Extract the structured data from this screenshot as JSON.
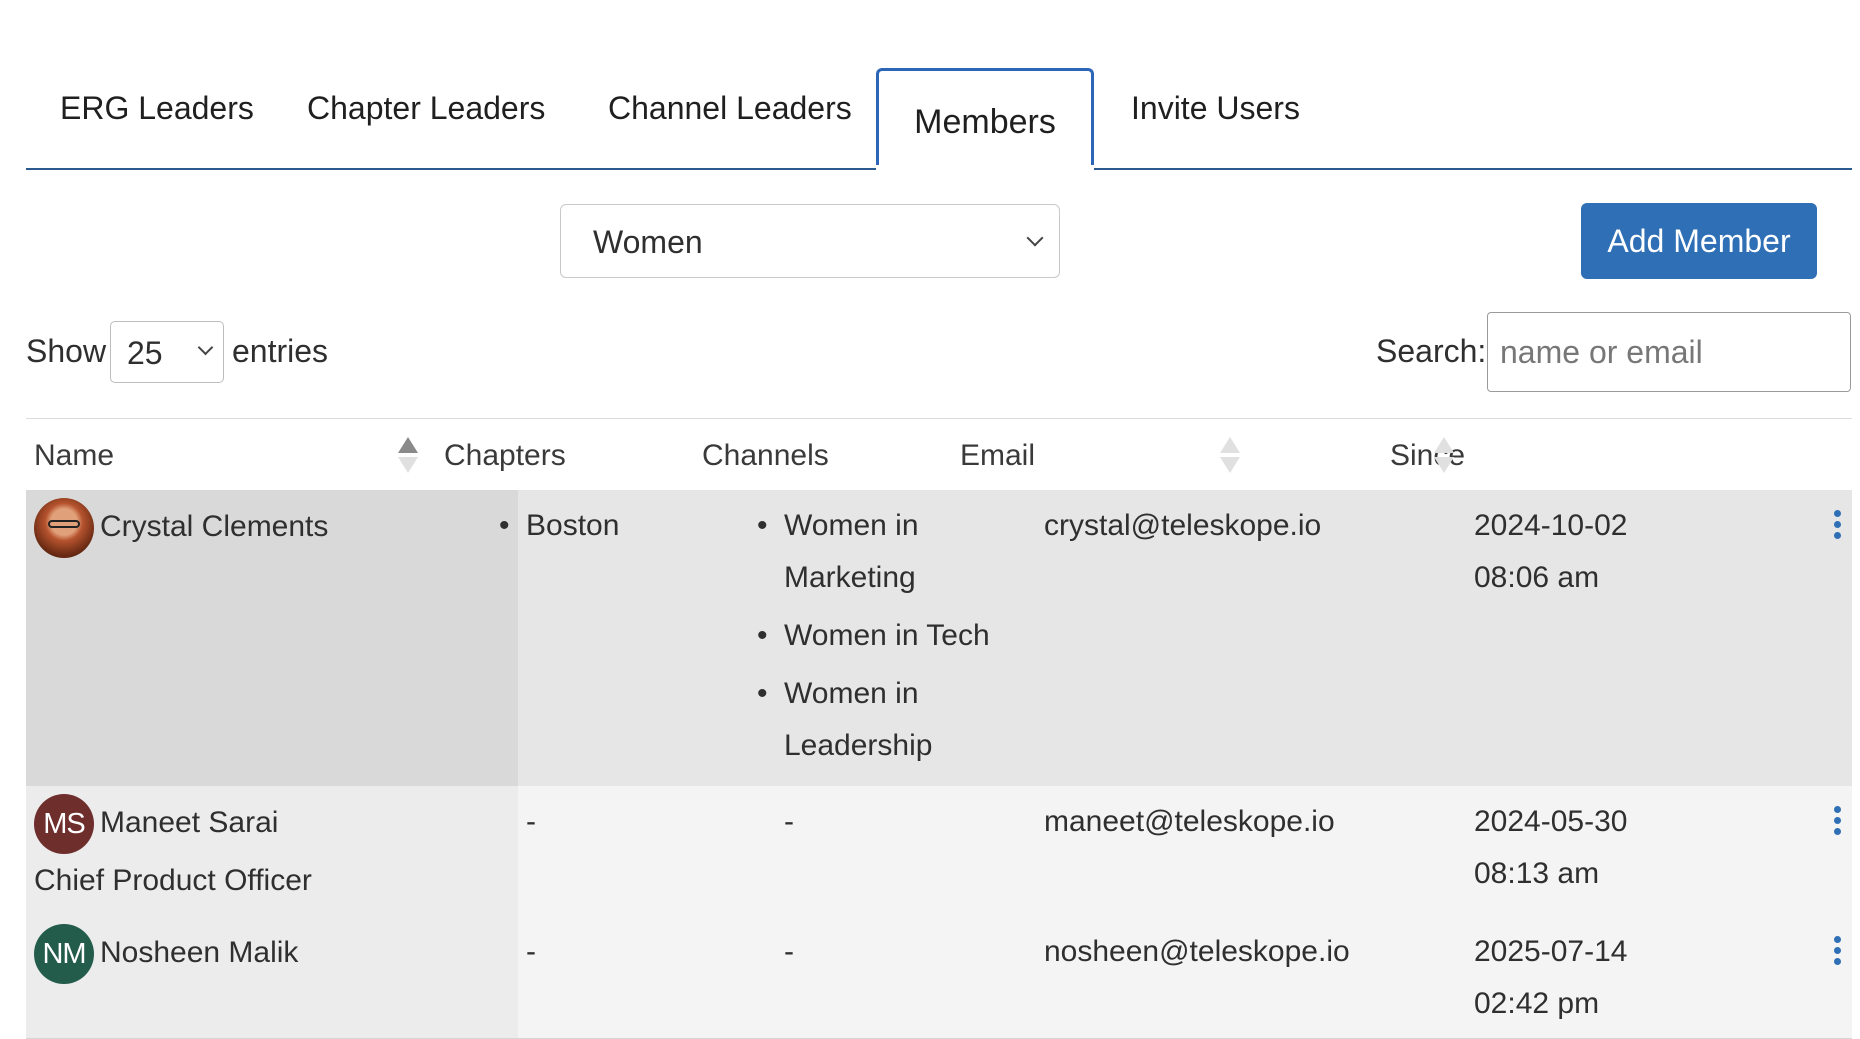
{
  "tabs": {
    "erg_leaders": "ERG Leaders",
    "chapter_leaders": "Chapter Leaders",
    "channel_leaders": "Channel Leaders",
    "members": "Members",
    "invite_users": "Invite Users",
    "active": "Members"
  },
  "filters": {
    "erg_selected": "Women",
    "add_member_label": "Add Member",
    "show_label": "Show",
    "entries_value": "25",
    "entries_label": "entries",
    "search_label": "Search:",
    "search_placeholder": "name or email",
    "search_value": ""
  },
  "table": {
    "headers": {
      "name": "Name",
      "chapters": "Chapters",
      "channels": "Channels",
      "email": "Email",
      "since": "Since"
    },
    "rows": [
      {
        "initials": "",
        "name": "Crystal Clements",
        "title": "",
        "chapters": [
          "Boston"
        ],
        "channels": [
          "Women in Marketing",
          "Women in Tech",
          "Women in Leadership"
        ],
        "email": "crystal@teleskope.io",
        "since_date": "2024-10-02",
        "since_time": "08:06 am"
      },
      {
        "initials": "MS",
        "avatar_color": "#6e2f2c",
        "name": "Maneet Sarai",
        "title": "Chief Product Officer",
        "chapters": "-",
        "channels": "-",
        "email": "maneet@teleskope.io",
        "since_date": "2024-05-30",
        "since_time": "08:13 am"
      },
      {
        "initials": "NM",
        "avatar_color": "#235c4b",
        "name": "Nosheen Malik",
        "title": "",
        "chapters": "-",
        "channels": "-",
        "email": "nosheen@teleskope.io",
        "since_date": "2025-07-14",
        "since_time": "02:42 pm"
      }
    ]
  },
  "colors": {
    "primary": "#2f6fb6",
    "tab_border": "#2b66b8",
    "row_highlight": "#e6e6e6"
  }
}
